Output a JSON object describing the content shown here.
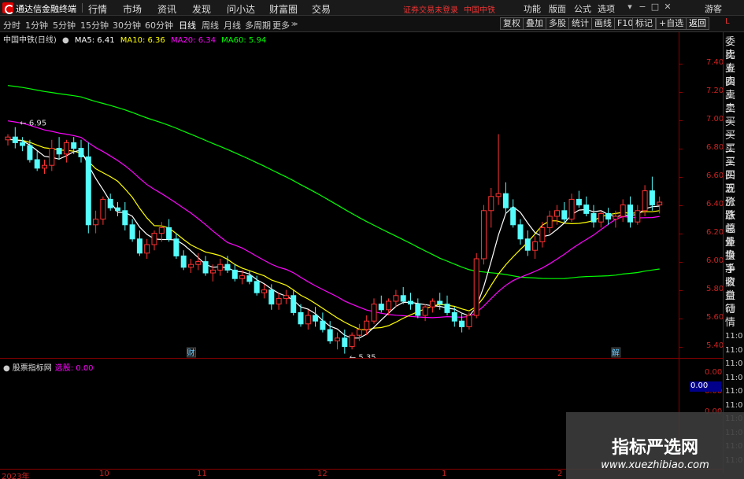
{
  "menubar": {
    "app_title": "通达信金融终端",
    "items": [
      "行情",
      "市场",
      "资讯",
      "发现",
      "问小达",
      "财富圈",
      "交易"
    ],
    "login_status": "证券交易未登录",
    "stock_title": "中国中铁",
    "right_items": [
      "功能",
      "版面",
      "公式",
      "选项"
    ],
    "guest": "游客"
  },
  "toolbar": {
    "timeframes": [
      "分时",
      "1分钟",
      "5分钟",
      "15分钟",
      "30分钟",
      "60分钟",
      "日线",
      "周线",
      "月线",
      "多周期",
      "更多"
    ],
    "active_timeframe": "日线",
    "buttons": [
      "复权",
      "叠加",
      "多股",
      "统计",
      "画线",
      "F10",
      "标记",
      "+自选",
      "返回"
    ]
  },
  "legend": {
    "stock": "中国中铁(日线)",
    "ma5": "MA5: 6.41",
    "ma10": "MA10: 6.36",
    "ma20": "MA20: 6.34",
    "ma60": "MA60: 5.94"
  },
  "colors": {
    "up": "#ff3232",
    "down": "#54fcfc",
    "ma5": "#ffffff",
    "ma10": "#ffff00",
    "ma20": "#ff00ff",
    "ma60": "#00ff00",
    "axis": "#c22222"
  },
  "axis_label_L": "L",
  "side_labels": [
    "委比",
    "卖五",
    "卖四",
    "卖三",
    "卖二",
    "卖一",
    "买一",
    "买二",
    "买三",
    "买四",
    "买五",
    "现价",
    "涨跌",
    "涨幅",
    "总量",
    "外盘",
    "换手",
    "净资",
    "收益",
    "自动",
    "行情"
  ],
  "side_times": [
    "11:0",
    "11:0",
    "11:0",
    "11:0",
    "11:0",
    "11:0",
    "11:0",
    "11:0",
    "11:0",
    "11:0"
  ],
  "chart_annotations": {
    "high_label": "6.95",
    "low_label": "5.35",
    "marker_1": "财",
    "marker_2": "解"
  },
  "indicator": {
    "name": "股票指标网",
    "series_label": "选股: 0.00",
    "value_box": "0.00",
    "ticks": [
      "0.00",
      "0.00",
      "0.00"
    ]
  },
  "date_axis": [
    "2023年",
    "10",
    "11",
    "12",
    "1",
    "2"
  ],
  "watermark": {
    "title": "指标严选网",
    "url": "www.xuezhibiao.com"
  },
  "chart_data": {
    "type": "candlestick",
    "title": "中国中铁(日线)",
    "y_ticks": [
      7.4,
      7.2,
      7.0,
      6.8,
      6.6,
      6.4,
      6.2,
      6.0,
      5.8,
      5.6,
      5.4
    ],
    "ylim": [
      5.32,
      7.62
    ],
    "x_months": [
      "2023年",
      "10",
      "11",
      "12",
      "1",
      "2"
    ],
    "candles": [
      [
        6.86,
        6.9,
        6.82,
        6.88
      ],
      [
        6.88,
        6.95,
        6.8,
        6.84
      ],
      [
        6.84,
        6.88,
        6.78,
        6.82
      ],
      [
        6.82,
        6.86,
        6.7,
        6.72
      ],
      [
        6.72,
        6.78,
        6.64,
        6.66
      ],
      [
        6.66,
        6.72,
        6.62,
        6.68
      ],
      [
        6.68,
        6.86,
        6.64,
        6.8
      ],
      [
        6.8,
        6.88,
        6.72,
        6.76
      ],
      [
        6.76,
        6.86,
        6.7,
        6.84
      ],
      [
        6.84,
        6.88,
        6.76,
        6.8
      ],
      [
        6.8,
        6.86,
        6.7,
        6.74
      ],
      [
        6.74,
        6.84,
        6.2,
        6.26
      ],
      [
        6.26,
        6.36,
        6.2,
        6.3
      ],
      [
        6.3,
        6.46,
        6.26,
        6.44
      ],
      [
        6.44,
        6.48,
        6.36,
        6.38
      ],
      [
        6.38,
        6.42,
        6.32,
        6.36
      ],
      [
        6.36,
        6.42,
        6.22,
        6.26
      ],
      [
        6.26,
        6.3,
        6.14,
        6.16
      ],
      [
        6.16,
        6.22,
        6.04,
        6.06
      ],
      [
        6.06,
        6.16,
        6.02,
        6.12
      ],
      [
        6.12,
        6.22,
        6.08,
        6.2
      ],
      [
        6.2,
        6.28,
        6.14,
        6.24
      ],
      [
        6.24,
        6.3,
        6.14,
        6.16
      ],
      [
        6.16,
        6.2,
        6.02,
        6.04
      ],
      [
        6.04,
        6.08,
        5.94,
        5.96
      ],
      [
        5.96,
        6.02,
        5.92,
        5.98
      ],
      [
        5.98,
        6.06,
        5.94,
        6.0
      ],
      [
        6.0,
        6.04,
        5.9,
        5.92
      ],
      [
        5.92,
        5.98,
        5.86,
        5.94
      ],
      [
        5.94,
        6.02,
        5.9,
        5.98
      ],
      [
        5.98,
        6.04,
        5.92,
        5.94
      ],
      [
        5.94,
        5.98,
        5.86,
        5.88
      ],
      [
        5.88,
        5.94,
        5.84,
        5.9
      ],
      [
        5.9,
        5.94,
        5.84,
        5.86
      ],
      [
        5.86,
        5.9,
        5.76,
        5.78
      ],
      [
        5.78,
        5.84,
        5.74,
        5.8
      ],
      [
        5.8,
        5.84,
        5.66,
        5.7
      ],
      [
        5.7,
        5.78,
        5.66,
        5.74
      ],
      [
        5.74,
        5.8,
        5.7,
        5.76
      ],
      [
        5.76,
        5.8,
        5.62,
        5.64
      ],
      [
        5.64,
        5.7,
        5.54,
        5.56
      ],
      [
        5.56,
        5.66,
        5.52,
        5.62
      ],
      [
        5.62,
        5.68,
        5.54,
        5.58
      ],
      [
        5.58,
        5.64,
        5.5,
        5.52
      ],
      [
        5.52,
        5.58,
        5.42,
        5.44
      ],
      [
        5.44,
        5.5,
        5.38,
        5.46
      ],
      [
        5.46,
        5.52,
        5.35,
        5.4
      ],
      [
        5.4,
        5.5,
        5.38,
        5.48
      ],
      [
        5.48,
        5.56,
        5.44,
        5.52
      ],
      [
        5.52,
        5.62,
        5.48,
        5.58
      ],
      [
        5.58,
        5.74,
        5.56,
        5.7
      ],
      [
        5.7,
        5.76,
        5.64,
        5.66
      ],
      [
        5.66,
        5.74,
        5.62,
        5.72
      ],
      [
        5.72,
        5.8,
        5.68,
        5.76
      ],
      [
        5.76,
        5.82,
        5.7,
        5.72
      ],
      [
        5.72,
        5.78,
        5.66,
        5.7
      ],
      [
        5.7,
        5.74,
        5.6,
        5.62
      ],
      [
        5.62,
        5.7,
        5.58,
        5.68
      ],
      [
        5.68,
        5.74,
        5.64,
        5.72
      ],
      [
        5.72,
        5.78,
        5.66,
        5.7
      ],
      [
        5.7,
        5.76,
        5.62,
        5.64
      ],
      [
        5.64,
        5.68,
        5.54,
        5.58
      ],
      [
        5.58,
        5.64,
        5.5,
        5.54
      ],
      [
        5.54,
        5.64,
        5.52,
        5.62
      ],
      [
        5.62,
        6.06,
        5.6,
        6.02
      ],
      [
        6.02,
        6.4,
        5.98,
        6.36
      ],
      [
        6.36,
        6.52,
        6.24,
        6.46
      ],
      [
        6.46,
        6.9,
        6.4,
        6.48
      ],
      [
        6.48,
        6.56,
        6.34,
        6.38
      ],
      [
        6.38,
        6.44,
        6.24,
        6.26
      ],
      [
        6.26,
        6.3,
        6.12,
        6.16
      ],
      [
        6.16,
        6.22,
        6.04,
        6.08
      ],
      [
        6.08,
        6.18,
        6.02,
        6.14
      ],
      [
        6.14,
        6.28,
        6.1,
        6.24
      ],
      [
        6.24,
        6.36,
        6.2,
        6.32
      ],
      [
        6.32,
        6.4,
        6.26,
        6.36
      ],
      [
        6.36,
        6.42,
        6.28,
        6.3
      ],
      [
        6.3,
        6.48,
        6.28,
        6.44
      ],
      [
        6.44,
        6.5,
        6.38,
        6.4
      ],
      [
        6.4,
        6.46,
        6.32,
        6.34
      ],
      [
        6.34,
        6.4,
        6.24,
        6.28
      ],
      [
        6.28,
        6.36,
        6.24,
        6.34
      ],
      [
        6.34,
        6.38,
        6.26,
        6.3
      ],
      [
        6.3,
        6.36,
        6.24,
        6.32
      ],
      [
        6.32,
        6.44,
        6.28,
        6.4
      ],
      [
        6.4,
        6.46,
        6.24,
        6.28
      ],
      [
        6.28,
        6.4,
        6.26,
        6.36
      ],
      [
        6.36,
        6.54,
        6.32,
        6.5
      ],
      [
        6.5,
        6.6,
        6.36,
        6.4
      ],
      [
        6.4,
        6.46,
        6.34,
        6.42
      ]
    ]
  }
}
